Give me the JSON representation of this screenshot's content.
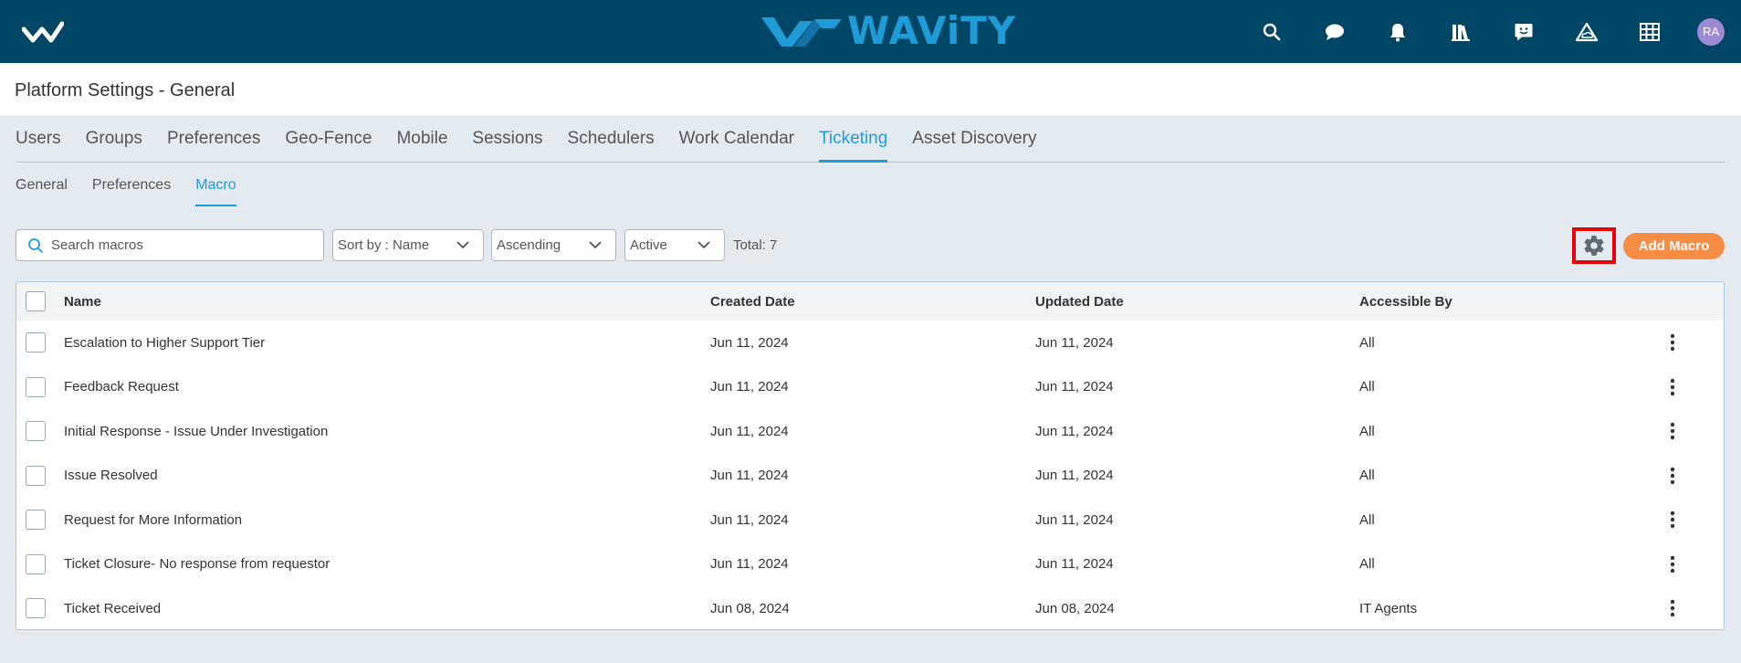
{
  "brand": {
    "name": "WAViTY"
  },
  "topbar": {
    "icons": [
      "search-icon",
      "chat-icon",
      "bell-icon",
      "library-icon",
      "feedback-icon",
      "cloud-alert-icon",
      "grid-icon"
    ],
    "avatar_initials": "RA"
  },
  "page": {
    "title": "Platform Settings - General"
  },
  "tabs": [
    "Users",
    "Groups",
    "Preferences",
    "Geo-Fence",
    "Mobile",
    "Sessions",
    "Schedulers",
    "Work Calendar",
    "Ticketing",
    "Asset Discovery"
  ],
  "active_tab": "Ticketing",
  "subtabs": [
    "General",
    "Preferences",
    "Macro"
  ],
  "active_subtab": "Macro",
  "toolbar": {
    "search_placeholder": "Search macros",
    "sort_by": "Sort by : Name",
    "order": "Ascending",
    "status": "Active",
    "total": "Total: 7",
    "add_label": "Add Macro"
  },
  "table": {
    "headers": [
      "Name",
      "Created Date",
      "Updated Date",
      "Accessible By"
    ],
    "rows": [
      [
        "Escalation to Higher Support Tier",
        "Jun 11, 2024",
        "Jun 11, 2024",
        "All"
      ],
      [
        "Feedback Request",
        "Jun 11, 2024",
        "Jun 11, 2024",
        "All"
      ],
      [
        "Initial Response - Issue Under Investigation",
        "Jun 11, 2024",
        "Jun 11, 2024",
        "All"
      ],
      [
        "Issue Resolved",
        "Jun 11, 2024",
        "Jun 11, 2024",
        "All"
      ],
      [
        "Request for More Information",
        "Jun 11, 2024",
        "Jun 11, 2024",
        "All"
      ],
      [
        "Ticket Closure- No response from requestor",
        "Jun 11, 2024",
        "Jun 11, 2024",
        "All"
      ],
      [
        "Ticket Received",
        "Jun 08, 2024",
        "Jun 08, 2024",
        "IT Agents"
      ]
    ]
  },
  "colors": {
    "topbar": "#004666",
    "accent": "#1f9bd7",
    "add_button": "#f78d45",
    "highlight": "#e8000b",
    "avatar": "#9c8ad6"
  }
}
